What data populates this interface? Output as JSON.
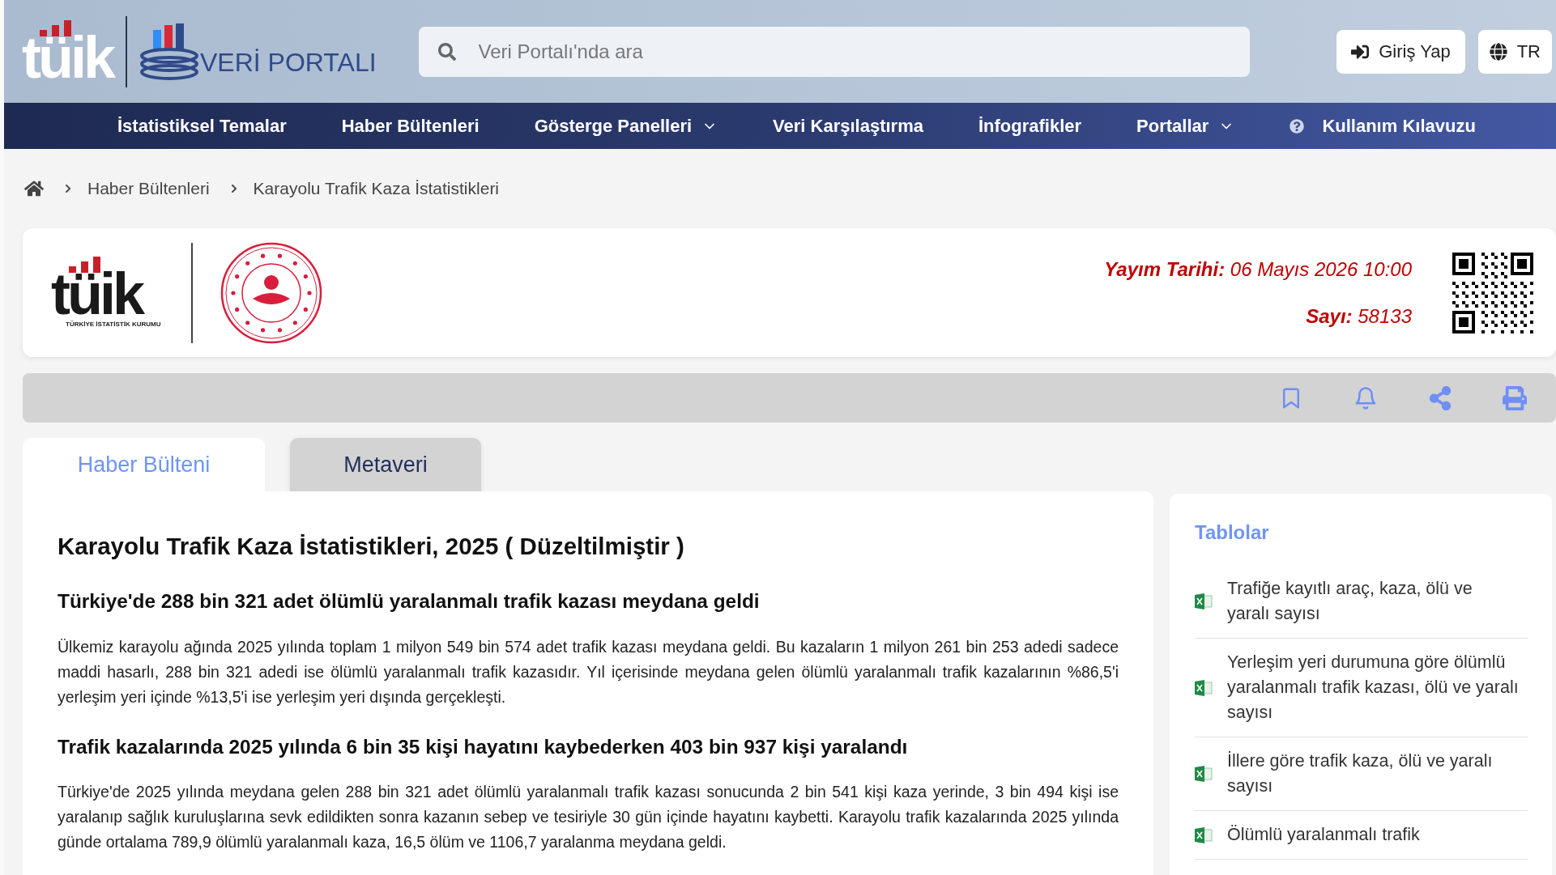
{
  "header": {
    "logo_text": "tüik",
    "portal_name": "VERİ PORTALI",
    "search": {
      "placeholder": "Veri Portalı'nda ara"
    },
    "login_button": "Giriş Yap",
    "language_button": "TR"
  },
  "nav": [
    {
      "label": "İstatistiksel Temalar",
      "kind": "link"
    },
    {
      "label": "Haber Bültenleri",
      "kind": "link"
    },
    {
      "label": "Gösterge Panelleri",
      "kind": "dropdown"
    },
    {
      "label": "Veri Karşılaştırma",
      "kind": "link"
    },
    {
      "label": "İnfografikler",
      "kind": "link"
    },
    {
      "label": "Portallar",
      "kind": "dropdown"
    },
    {
      "label": "Kullanım Kılavuzu",
      "kind": "help"
    }
  ],
  "breadcrumb": [
    "Haber Bültenleri",
    "Karayolu Trafik Kaza İstatistikleri"
  ],
  "bulletin_card": {
    "logo_text": "tüik",
    "logo_caption": "TÜRKİYE İSTATİSTİK KURUMU",
    "date_label": "Yayım Tarihi:",
    "date_value": "06 Mayıs 2026 10:00",
    "number_label": "Sayı:",
    "number_value": "58133"
  },
  "tabs": [
    {
      "label": "Haber Bülteni",
      "selected": true
    },
    {
      "label": "Metaveri",
      "selected": false
    }
  ],
  "article": {
    "title": "Karayolu Trafik Kaza İstatistikleri, 2025 ( Düzeltilmiştir )",
    "sections": [
      {
        "heading": "Türkiye'de 288 bin 321 adet ölümlü yaralanmalı trafik kazası meydana geldi",
        "text": "Ülkemiz karayolu ağında 2025 yılında toplam 1 milyon 549 bin 574 adet trafik kazası meydana geldi. Bu kazaların 1 milyon 261 bin 253 adedi sadece maddi hasarlı, 288 bin 321 adedi ise ölümlü yaralanmalı trafik kazasıdır. Yıl içerisinde meydana gelen ölümlü yaralanmalı trafik kazalarının %86,5'i yerleşim yeri içinde %13,5'i ise yerleşim yeri dışında gerçekleşti."
      },
      {
        "heading": "Trafik kazalarında 2025 yılında 6 bin 35 kişi hayatını kaybederken 403 bin 937 kişi yaralandı",
        "text": "Türkiye'de 2025 yılında meydana gelen 288 bin 321 adet ölümlü yaralanmalı trafik kazası sonucunda 2 bin 541 kişi kaza yerinde, 3 bin 494 kişi ise yaralanıp sağlık kuruluşlarına sevk edildikten sonra kazanın sebep ve tesiriyle 30 gün içinde hayatını kaybetti. Karayolu trafik kazalarında 2025 yılında günde ortalama 789,9 ölümlü yaralanmalı kaza, 16,5 ölüm ve 1106,7 yaralanma meydana geldi."
      }
    ]
  },
  "tables": {
    "title": "Tablolar",
    "items": [
      "Trafiğe kayıtlı araç, kaza, ölü ve yaralı sayısı",
      "Yerleşim yeri durumuna göre ölümlü yaralanmalı trafik kazası, ölü ve yaralı sayısı",
      "İllere göre trafik kaza, ölü ve yaralı sayısı",
      "Ölümlü yaralanmalı trafik"
    ]
  }
}
